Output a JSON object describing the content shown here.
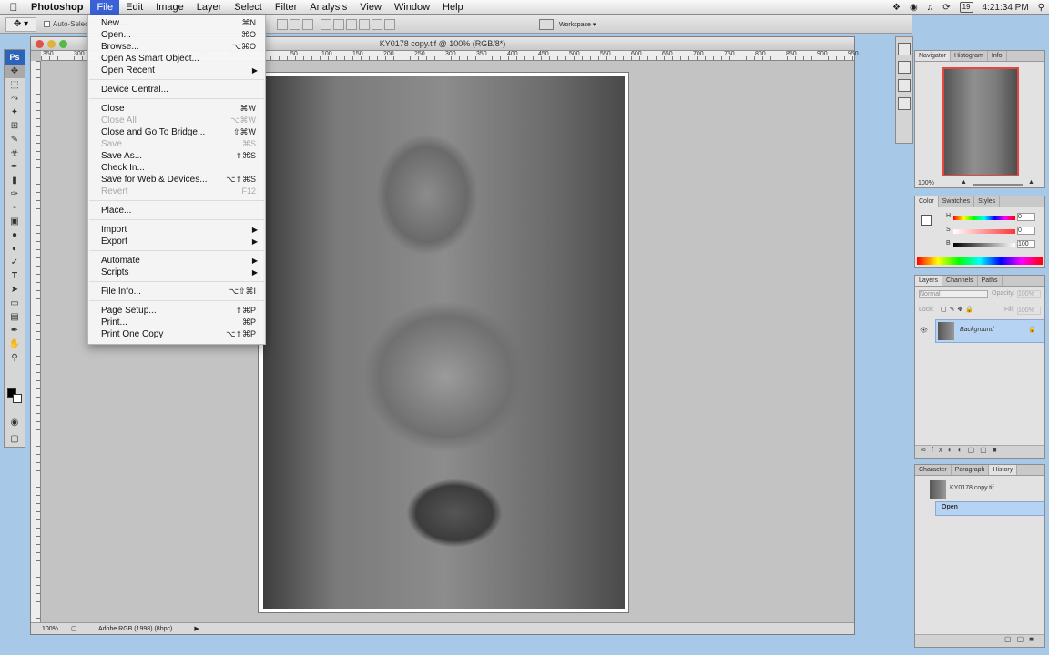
{
  "menubar": {
    "app_name": "Photoshop",
    "menus": [
      "File",
      "Edit",
      "Image",
      "Layer",
      "Select",
      "Filter",
      "Analysis",
      "View",
      "Window",
      "Help"
    ],
    "clock": "4:21:34 PM",
    "date_box": "19"
  },
  "options_bar": {
    "auto_select_label": "Auto-Select:",
    "workspace_label": "Workspace ▾"
  },
  "tools": {
    "logo": "Ps"
  },
  "document": {
    "title": "KY0178 copy.tif @ 100% (RGB/8*)",
    "ruler_numbers": [
      "350",
      "300",
      "250",
      "200",
      "150",
      "100",
      "50",
      "0",
      "50",
      "100",
      "150",
      "200",
      "250",
      "300",
      "350",
      "400",
      "450",
      "500",
      "550",
      "600",
      "650",
      "700",
      "750",
      "800",
      "850",
      "900",
      "950"
    ],
    "status_zoom": "100%",
    "status_profile": "Adobe RGB (1998) (8bpc)"
  },
  "file_menu": {
    "items": [
      {
        "label": "New...",
        "shortcut": "⌘N",
        "disabled": false
      },
      {
        "label": "Open...",
        "shortcut": "⌘O",
        "disabled": false
      },
      {
        "label": "Browse...",
        "shortcut": "⌥⌘O",
        "disabled": false
      },
      {
        "label": "Open As Smart Object...",
        "shortcut": "",
        "disabled": false
      },
      {
        "label": "Open Recent",
        "shortcut": "",
        "disabled": false,
        "submenu": true
      },
      {
        "label": "Device Central...",
        "shortcut": "",
        "disabled": false
      },
      {
        "label": "Close",
        "shortcut": "⌘W",
        "disabled": false
      },
      {
        "label": "Close All",
        "shortcut": "⌥⌘W",
        "disabled": true
      },
      {
        "label": "Close and Go To Bridge...",
        "shortcut": "⇧⌘W",
        "disabled": false
      },
      {
        "label": "Save",
        "shortcut": "⌘S",
        "disabled": true
      },
      {
        "label": "Save As...",
        "shortcut": "⇧⌘S",
        "disabled": false
      },
      {
        "label": "Check In...",
        "shortcut": "",
        "disabled": false
      },
      {
        "label": "Save for Web & Devices...",
        "shortcut": "⌥⇧⌘S",
        "disabled": false
      },
      {
        "label": "Revert",
        "shortcut": "F12",
        "disabled": true
      },
      {
        "label": "Place...",
        "shortcut": "",
        "disabled": false
      },
      {
        "label": "Import",
        "shortcut": "",
        "disabled": false,
        "submenu": true
      },
      {
        "label": "Export",
        "shortcut": "",
        "disabled": false,
        "submenu": true
      },
      {
        "label": "Automate",
        "shortcut": "",
        "disabled": false,
        "submenu": true
      },
      {
        "label": "Scripts",
        "shortcut": "",
        "disabled": false,
        "submenu": true
      },
      {
        "label": "File Info...",
        "shortcut": "⌥⇧⌘I",
        "disabled": false
      },
      {
        "label": "Page Setup...",
        "shortcut": "⇧⌘P",
        "disabled": false
      },
      {
        "label": "Print...",
        "shortcut": "⌘P",
        "disabled": false
      },
      {
        "label": "Print One Copy",
        "shortcut": "⌥⇧⌘P",
        "disabled": false
      }
    ]
  },
  "navigator": {
    "tabs": [
      "Navigator",
      "Histogram",
      "Info"
    ],
    "zoom": "100%"
  },
  "color_panel": {
    "tabs": [
      "Color",
      "Swatches",
      "Styles"
    ],
    "channels": [
      {
        "label": "H",
        "value": "0"
      },
      {
        "label": "S",
        "value": "0"
      },
      {
        "label": "B",
        "value": "100"
      }
    ]
  },
  "layers_panel": {
    "tabs": [
      "Layers",
      "Channels",
      "Paths"
    ],
    "blend_mode": "Normal",
    "opacity_label": "Opacity:",
    "opacity": "100%",
    "lock_label": "Lock:",
    "fill_label": "Fill:",
    "fill": "100%",
    "layer_name": "Background"
  },
  "history_panel": {
    "tabs": [
      "Character",
      "Paragraph",
      "History"
    ],
    "snapshot": "KY0178 copy.tif",
    "state": "Open"
  }
}
